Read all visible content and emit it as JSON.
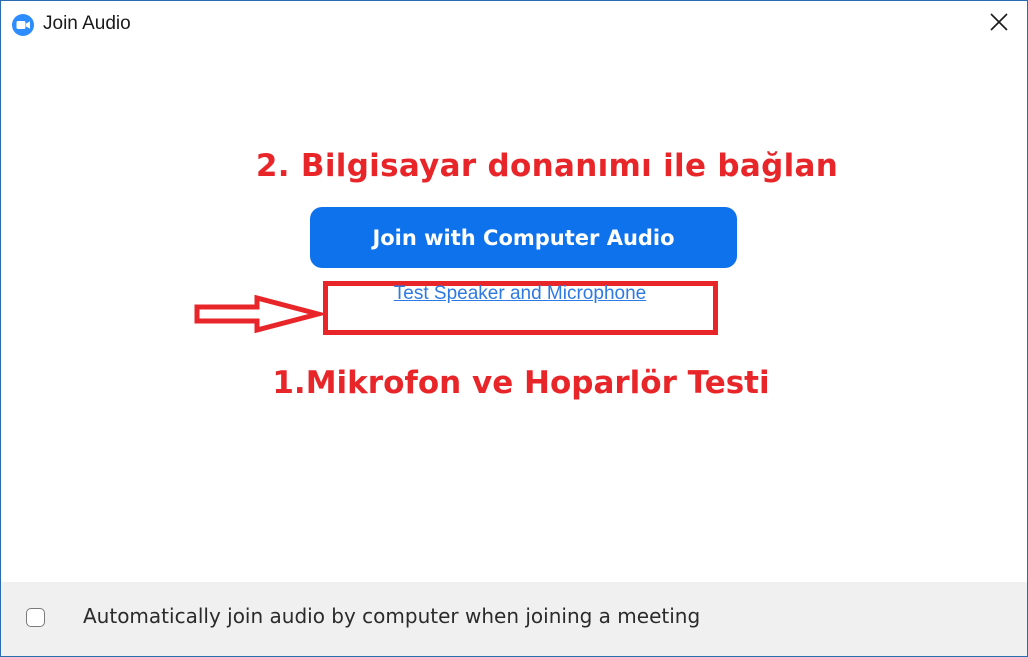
{
  "window": {
    "title": "Join Audio",
    "app_icon": "zoom-camera-icon",
    "close_icon": "close-icon"
  },
  "annotations": {
    "step2": "2. Bilgisayar donanımı ile bağlan",
    "step1": "1.Mikrofon ve Hoparlör Testi",
    "arrow_icon": "red-arrow-icon",
    "color": "#e8262a"
  },
  "main": {
    "join_button_label": "Join with Computer Audio",
    "test_link_label": "Test Speaker and Microphone",
    "accent": "#0e72ed",
    "link_color": "#2d7ae5"
  },
  "footer": {
    "auto_join_label": "Automatically join audio by computer when joining a meeting",
    "auto_join_checked": false
  }
}
